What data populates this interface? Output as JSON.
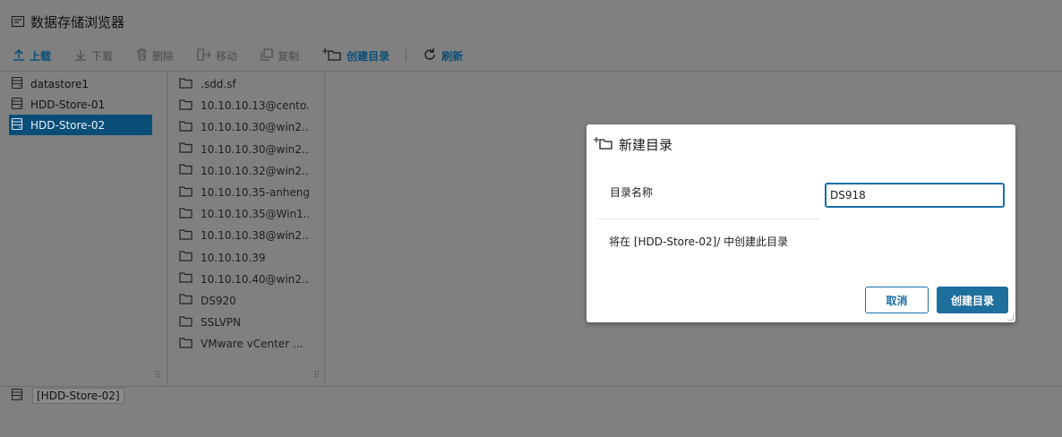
{
  "title": "数据存储浏览器",
  "toolbar": {
    "upload": "上载",
    "download": "下载",
    "delete": "删除",
    "move": "移动",
    "copy": "复制",
    "create_dir": "创建目录",
    "refresh": "刷新"
  },
  "datastores": [
    {
      "name": "datastore1",
      "selected": false
    },
    {
      "name": "HDD-Store-01",
      "selected": false
    },
    {
      "name": "HDD-Store-02",
      "selected": true
    }
  ],
  "folders": [
    ".sdd.sf",
    "10.10.10.13@cento...",
    "10.10.10.30@win2...",
    "10.10.10.30@win2...",
    "10.10.10.32@win2...",
    "10.10.10.35-anheng",
    "10.10.10.35@Win1...",
    "10.10.10.38@win2...",
    "10.10.10.39",
    "10.10.10.40@win2...",
    "DS920",
    "SSLVPN",
    "VMware vCenter ..."
  ],
  "status_path": "[HDD-Store-02]",
  "dialog": {
    "title": "新建目录",
    "name_label": "目录名称",
    "name_value": "DS918",
    "info": "将在 [HDD-Store-02]/ 中创建此目录",
    "cancel": "取消",
    "create": "创建目录"
  },
  "colors": {
    "accent": "#0a4e78",
    "button_primary": "#1f6f9e",
    "overlay": "#808080"
  }
}
